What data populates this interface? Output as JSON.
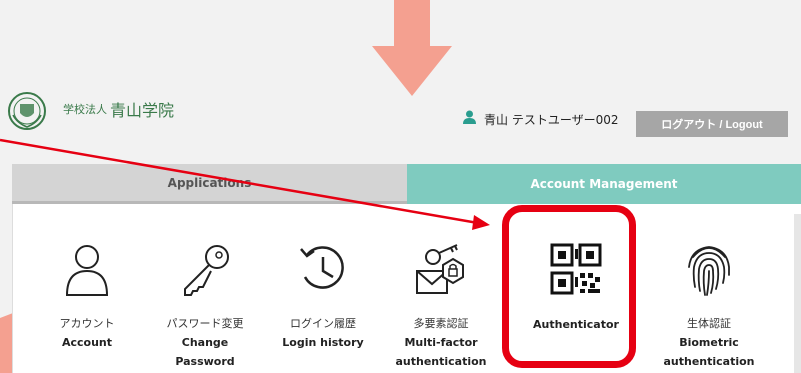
{
  "header": {
    "school_prefix": "学校法人",
    "school_name": "青山学院",
    "user_name": "青山 テストユーザー002",
    "logout_label": "ログアウト / Logout"
  },
  "tabs": [
    {
      "label": "Applications",
      "active": false
    },
    {
      "label": "Account Management",
      "active": true
    }
  ],
  "items": [
    {
      "icon": "person-icon",
      "jp": "アカウント",
      "en": "Account"
    },
    {
      "icon": "key-icon",
      "jp": "パスワード変更",
      "en": "Change Password"
    },
    {
      "icon": "history-icon",
      "jp": "ログイン履歴",
      "en": "Login history"
    },
    {
      "icon": "multifactor-icon",
      "jp": "多要素認証",
      "en": "Multi-factor authentication"
    },
    {
      "icon": "qr-code-icon",
      "jp": "",
      "en": "Authenticator"
    },
    {
      "icon": "fingerprint-icon",
      "jp": "生体認証",
      "en": "Biometric authentication"
    }
  ],
  "colors": {
    "accent": "#7fcbbf",
    "highlight": "#e60012",
    "arrow": "#f4a090",
    "school_green": "#3a7a4a"
  }
}
